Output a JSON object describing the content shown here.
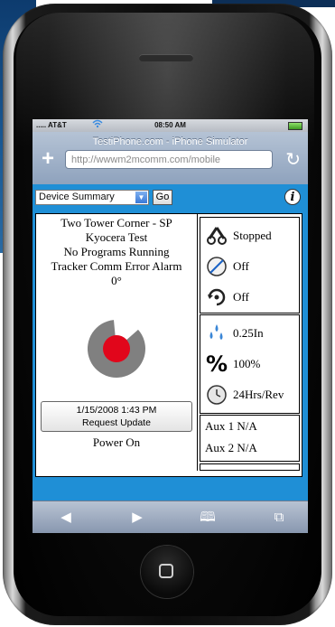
{
  "status_bar": {
    "carrier": "..... AT&T",
    "time": "08:50 AM"
  },
  "browser": {
    "title": "TestiPhone.com - iPhone Simulator",
    "url": "http://wwwm2mcomm.com/mobile",
    "add_label": "+",
    "reload_label": "↻"
  },
  "toolbar": {
    "view_select": "Device Summary",
    "go_label": "Go",
    "info_label": "i"
  },
  "device": {
    "name": "Two Tower Corner - SP",
    "location": "Kyocera Test",
    "program_status": "No Programs Running",
    "alarm": "Tracker Comm Error Alarm",
    "angle": "0°",
    "angle_fraction_open": 0.15,
    "last_update": "1/15/2008 1:43 PM",
    "request_update_label": "Request Update",
    "power": "Power On"
  },
  "status_rows": [
    {
      "icon": "movement-icon",
      "text": "Stopped"
    },
    {
      "icon": "no-entry-icon",
      "text": "Off"
    },
    {
      "icon": "rotate-icon",
      "text": "Off"
    }
  ],
  "sensor_rows": [
    {
      "icon": "water-drops-icon",
      "text": "0.25In"
    },
    {
      "icon": "percent-icon",
      "text": "100%"
    },
    {
      "icon": "clock-icon",
      "text": "24Hrs/Rev"
    }
  ],
  "aux": [
    {
      "text": "Aux 1 N/A"
    },
    {
      "text": "Aux 2 N/A"
    }
  ],
  "bottom_bar": {
    "back": "◀",
    "forward": "▶",
    "bookmarks": "🕮",
    "pages": "⧉"
  },
  "colors": {
    "content_bg": "#1f8fd6",
    "pie_red": "#e1061b",
    "pie_gray": "#808080"
  }
}
